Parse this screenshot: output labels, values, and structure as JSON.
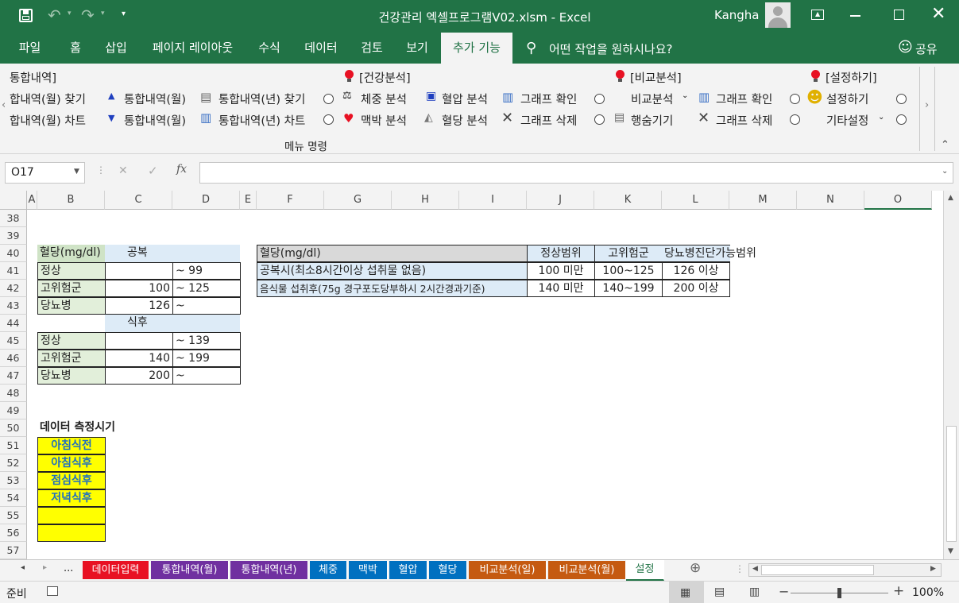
{
  "window": {
    "title": "건강관리 엑셀프로그램V02.xlsm  -  Excel",
    "user": "Kangha"
  },
  "colors": {
    "brand": "#217346",
    "red_tab": "#e81123",
    "purple_tab": "#7030a0",
    "blue_tab": "#0070c0",
    "orange_tab": "#c55a11",
    "yellow": "#ffff00",
    "green_fill": "#cfe3c6",
    "blue_fill": "#ddebf7",
    "gray_fill": "#d9d9d9"
  },
  "ribbon_tabs": [
    {
      "label": "파일"
    },
    {
      "label": "홈"
    },
    {
      "label": "삽입"
    },
    {
      "label": "페이지 레이아웃"
    },
    {
      "label": "수식"
    },
    {
      "label": "데이터"
    },
    {
      "label": "검토"
    },
    {
      "label": "보기"
    },
    {
      "label": "추가 기능"
    }
  ],
  "tell_me": "어떤 작업을 원하시나요?",
  "share": "공유",
  "ribbon": {
    "group1_title": "통합내역]",
    "g1_r1a": "합내역(월) 찾기",
    "g1_r1b": "통합내역(월)",
    "g1_r1c": "통합내역(년) 찾기",
    "g1_r2a": "합내역(월) 차트",
    "g1_r2b": "통합내역(월)",
    "g1_r2c": "통합내역(년) 차트",
    "health_title": "[건강분석]",
    "weight": "체중 분석",
    "bp": "혈압 분석",
    "graph_confirm": "그래프 확인",
    "pulse": "맥박 분석",
    "sugar": "혈당 분석",
    "graph_delete": "그래프 삭제",
    "compare_title": "[비교분석]",
    "compare_dd": "비교분석",
    "graph_confirm2": "그래프 확인",
    "hide_rows": "행숨기기",
    "graph_delete2": "그래프 삭제",
    "settings_title": "[설정하기]",
    "settings": "설정하기",
    "other_settings": "기타설정",
    "group_label": "메뉴 명령"
  },
  "formula": {
    "name_box": "O17",
    "fx": "fx",
    "value": ""
  },
  "columns": [
    "A",
    "B",
    "C",
    "D",
    "E",
    "F",
    "G",
    "H",
    "I",
    "J",
    "K",
    "L",
    "M",
    "N",
    "O"
  ],
  "rows": [
    "38",
    "39",
    "40",
    "41",
    "42",
    "43",
    "44",
    "45",
    "46",
    "47",
    "48",
    "49",
    "50",
    "51",
    "52",
    "53",
    "54",
    "55",
    "56",
    "57"
  ],
  "t1": {
    "h_label": "혈당(mg/dl)",
    "h_fasting": "공복",
    "r1a": "정상",
    "r1c": "",
    "r1d": "~ 99",
    "r2a": "고위험군",
    "r2c": "100",
    "r2d": "~ 125",
    "r3a": "당뇨병",
    "r3c": "126",
    "r3d": "~",
    "h_after": "식후",
    "r4a": "정상",
    "r4c": "",
    "r4d": "~ 139",
    "r5a": "고위험군",
    "r5c": "140",
    "r5d": "~ 199",
    "r6a": "당뇨병",
    "r6c": "200",
    "r6d": "~"
  },
  "t2": {
    "h0": "혈당(mg/dl)",
    "h1": "정상범위",
    "h2": "고위험군",
    "h3": "당뇨병진단가능범위",
    "r1_0": "공복시(최소8시간이상 섭취물 없음)",
    "r1_1": "100 미만",
    "r1_2": "100~125",
    "r1_3": "126 이상",
    "r2_0": "음식물 섭취후(75g 경구포도당부하시 2시간경과기준)",
    "r2_1": "140 미만",
    "r2_2": "140~199",
    "r2_3": "200 이상"
  },
  "t3": {
    "title": "데이터 측정시기",
    "items": [
      "아침식전",
      "아침식후",
      "점심식후",
      "저녁식후",
      "",
      ""
    ]
  },
  "sheet_tabs": [
    {
      "label": "데이터입력"
    },
    {
      "label": "통합내역(월)"
    },
    {
      "label": "통합내역(년)"
    },
    {
      "label": "체중"
    },
    {
      "label": "맥박"
    },
    {
      "label": "혈압"
    },
    {
      "label": "혈당"
    },
    {
      "label": "비교분석(일)"
    },
    {
      "label": "비교분석(월)"
    },
    {
      "label": "설정"
    }
  ],
  "ellipsis": "...",
  "status": {
    "ready": "준비",
    "zoom": "100%"
  }
}
